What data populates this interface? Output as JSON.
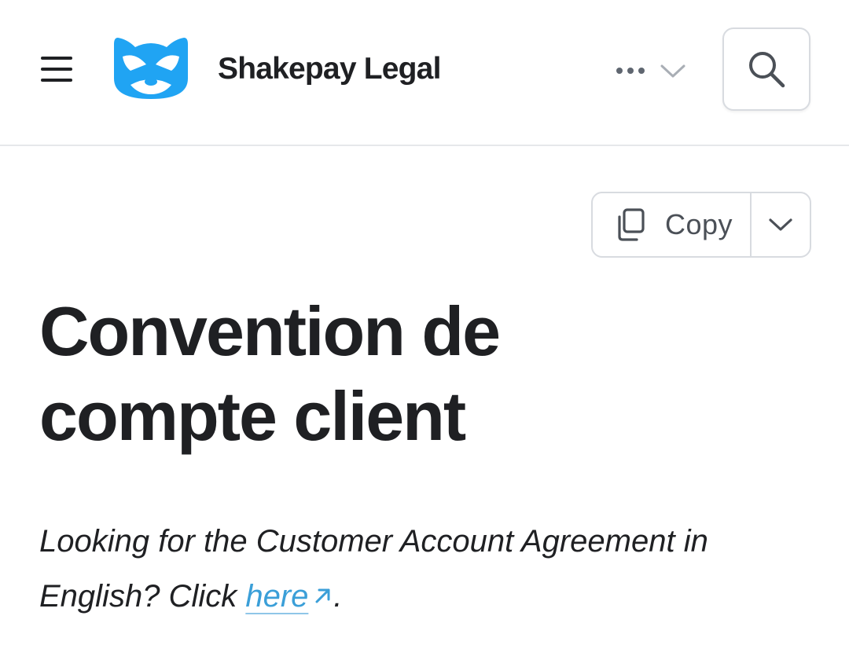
{
  "header": {
    "site_title": "Shakepay Legal",
    "menu_icon": "hamburger-menu-icon",
    "logo_icon": "raccoon-logo-icon",
    "more_icon": "ellipsis-icon",
    "more_chevron": "chevron-down-icon",
    "search_icon": "search-icon"
  },
  "toolbar": {
    "copy_label": "Copy",
    "copy_icon": "copy-icon",
    "dropdown_icon": "chevron-down-icon"
  },
  "main": {
    "title": "Convention de compte client",
    "intro_before_link": "Looking for the Customer Account Agreement in English? Click ",
    "link_text": "here",
    "link_icon": "external-link-icon",
    "intro_after_link": "."
  },
  "colors": {
    "brand_blue": "#20a4f3",
    "link": "#3b9fd8",
    "text": "#1f2023",
    "border": "#d8dbe0"
  }
}
